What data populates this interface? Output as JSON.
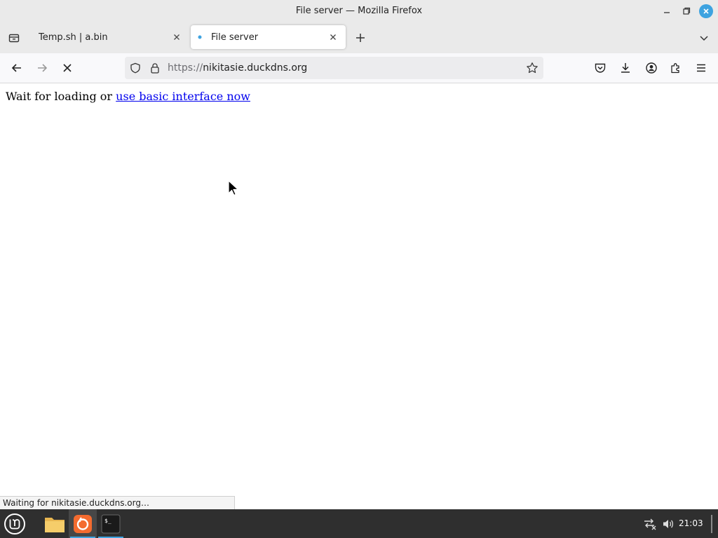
{
  "window": {
    "title": "File server — Mozilla Firefox"
  },
  "tabs": [
    {
      "label": "Temp.sh | a.bin",
      "active": false
    },
    {
      "label": "File server",
      "active": true
    }
  ],
  "navbar": {
    "url_scheme": "https://",
    "url_host": "nikitasie.duckdns.org"
  },
  "page": {
    "text": "Wait for loading or ",
    "link": "use basic interface now"
  },
  "status": {
    "text": "Waiting for nikitasie.duckdns.org…"
  },
  "taskbar": {
    "clock": "21:03"
  },
  "colors": {
    "accent": "#3ea3e0",
    "link": "#0000ee",
    "taskbar": "#2f2f2f"
  }
}
